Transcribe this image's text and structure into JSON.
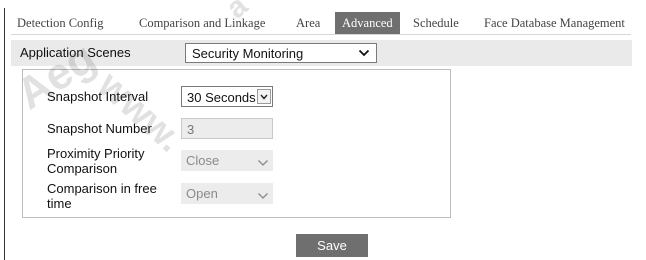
{
  "tabs": [
    {
      "label": "Detection Config",
      "active": false
    },
    {
      "label": "Comparison and Linkage",
      "active": false
    },
    {
      "label": "Area",
      "active": false
    },
    {
      "label": "Advanced",
      "active": true
    },
    {
      "label": "Schedule",
      "active": false
    },
    {
      "label": "Face Database Management",
      "active": false
    }
  ],
  "application_scenes": {
    "label": "Application Scenes",
    "value": "Security Monitoring"
  },
  "settings": {
    "snapshot_interval": {
      "label": "Snapshot Interval",
      "value": "30 Seconds"
    },
    "snapshot_number": {
      "label": "Snapshot Number",
      "value": "3"
    },
    "proximity_priority": {
      "label": "Proximity Priority Comparison",
      "value": "Close"
    },
    "comparison_free_time": {
      "label": "Comparison in free time",
      "value": "Open"
    }
  },
  "save_label": "Save",
  "watermark": {
    "w1": "Aeg",
    "w2": "www.",
    "w3": "a"
  },
  "colors": {
    "active_tab": "#6f6f6f",
    "button": "#6f6f6f",
    "scene_row": "#eaeaea",
    "disabled_field": "#ececec"
  }
}
